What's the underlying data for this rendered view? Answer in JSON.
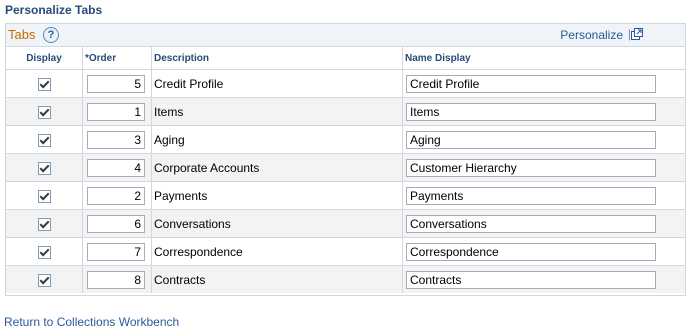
{
  "page": {
    "title": "Personalize Tabs"
  },
  "grid": {
    "title": "Tabs",
    "help_label": "?",
    "personalize_link": "Personalize",
    "separator": "|",
    "columns": {
      "display": "Display",
      "order": "*Order",
      "description": "Description",
      "name_display": "Name Display"
    },
    "rows": [
      {
        "order": "5",
        "description": "Credit Profile",
        "name_display": "Credit Profile",
        "checked": true
      },
      {
        "order": "1",
        "description": "Items",
        "name_display": "Items",
        "checked": true
      },
      {
        "order": "3",
        "description": "Aging",
        "name_display": "Aging",
        "checked": true
      },
      {
        "order": "4",
        "description": "Corporate Accounts",
        "name_display": "Customer Hierarchy",
        "checked": true
      },
      {
        "order": "2",
        "description": "Payments",
        "name_display": "Payments",
        "checked": true
      },
      {
        "order": "6",
        "description": "Conversations",
        "name_display": "Conversations",
        "checked": true
      },
      {
        "order": "7",
        "description": "Correspondence",
        "name_display": "Correspondence",
        "checked": true
      },
      {
        "order": "8",
        "description": "Contracts",
        "name_display": "Contracts",
        "checked": true
      }
    ]
  },
  "footer": {
    "return_link": "Return to Collections Workbench"
  }
}
